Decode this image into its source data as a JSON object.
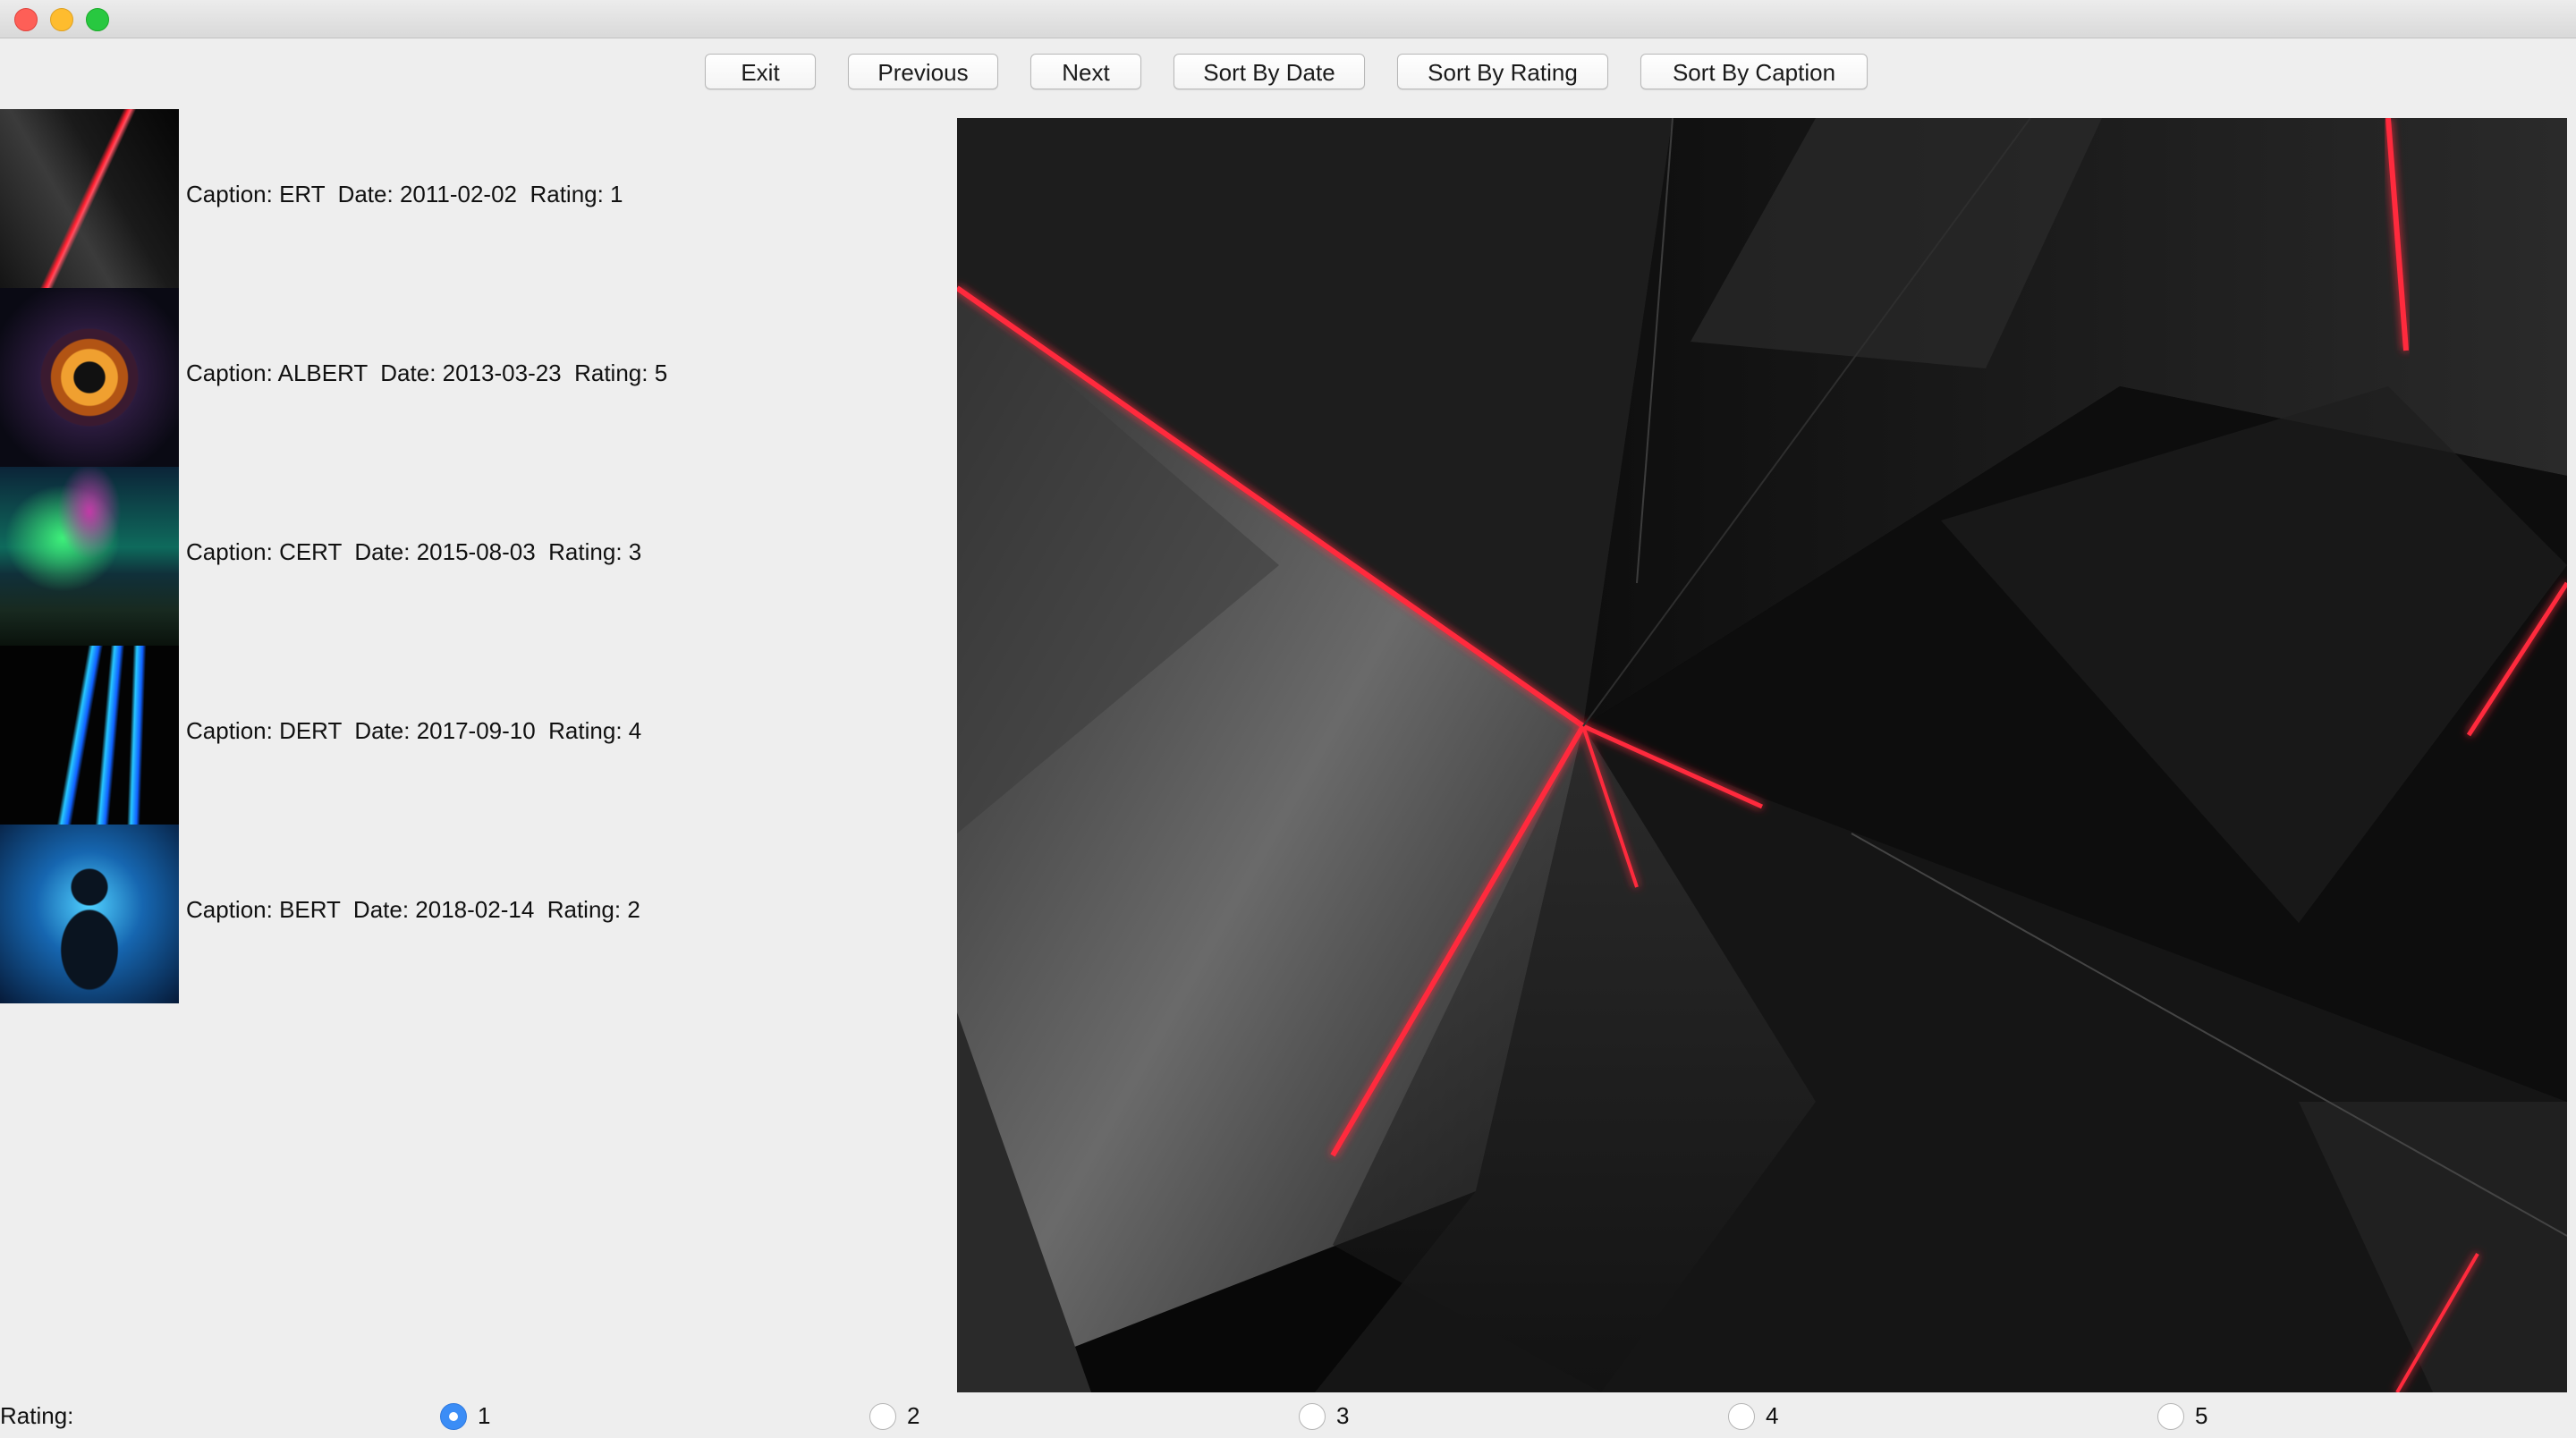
{
  "toolbar": {
    "exit_label": "Exit",
    "previous_label": "Previous",
    "next_label": "Next",
    "sort_date_label": "Sort By Date",
    "sort_rating_label": "Sort By Rating",
    "sort_caption_label": "Sort By Caption"
  },
  "list": {
    "items": [
      {
        "text": "Caption: ERT  Date: 2011-02-02  Rating: 1",
        "caption": "ERT",
        "date": "2011-02-02",
        "rating": 1
      },
      {
        "text": "Caption: ALBERT  Date: 2013-03-23  Rating: 5",
        "caption": "ALBERT",
        "date": "2013-03-23",
        "rating": 5
      },
      {
        "text": "Caption: CERT  Date: 2015-08-03  Rating: 3",
        "caption": "CERT",
        "date": "2015-08-03",
        "rating": 3
      },
      {
        "text": "Caption: DERT  Date: 2017-09-10  Rating: 4",
        "caption": "DERT",
        "date": "2017-09-10",
        "rating": 4
      },
      {
        "text": "Caption: BERT  Date: 2018-02-14  Rating: 2",
        "caption": "BERT",
        "date": "2018-02-14",
        "rating": 2
      }
    ]
  },
  "rating": {
    "label": "Rating:",
    "options": [
      "1",
      "2",
      "3",
      "4",
      "5"
    ],
    "selected": "1"
  },
  "colors": {
    "accent": "#3b8df6",
    "window_bg": "#eeeeee"
  }
}
